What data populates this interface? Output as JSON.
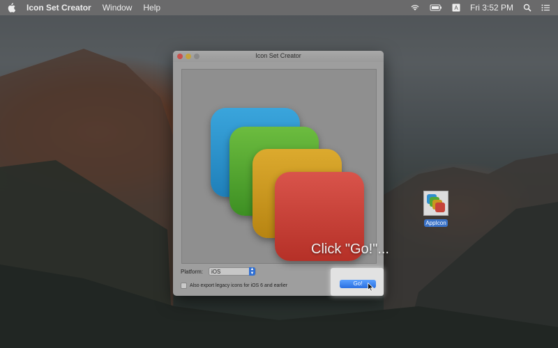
{
  "menubar": {
    "app_name": "Icon Set Creator",
    "menus": [
      "Window",
      "Help"
    ],
    "clock": "Fri 3:52 PM",
    "icons": [
      "apple-icon",
      "wifi-icon",
      "battery-icon",
      "keyboard-input-icon",
      "search-icon",
      "notification-center-icon"
    ]
  },
  "window": {
    "title": "Icon Set Creator",
    "platform_label": "Platform:",
    "platform_value": "iOS",
    "legacy_label": "Also export legacy icons for iOS 6 and earlier",
    "legacy_checked": false,
    "go_label": "Go!"
  },
  "desktop": {
    "file_label": "AppIcon"
  },
  "overlay": {
    "caption": "Click \"Go!\"..."
  },
  "colors": {
    "blue": "#2f8fcf",
    "green": "#55a832",
    "yellow": "#c9981f",
    "red": "#c7443a",
    "accent": "#2a6fe0"
  }
}
